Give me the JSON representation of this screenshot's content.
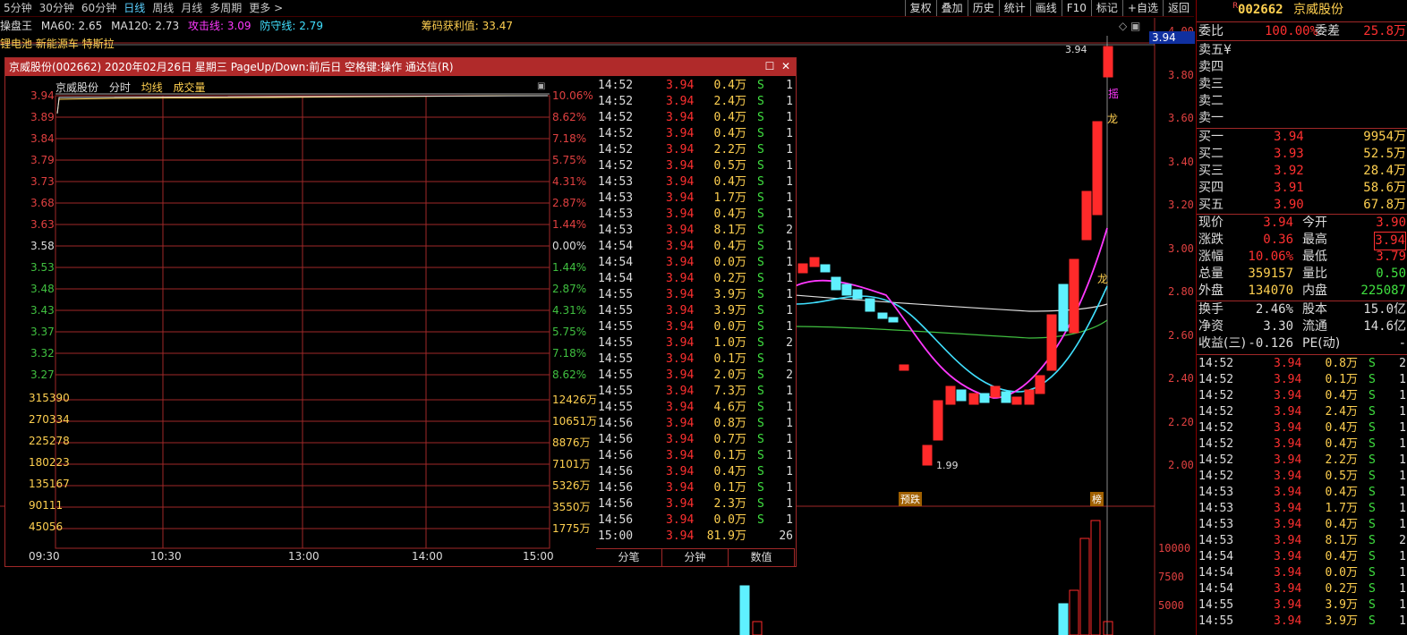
{
  "periods": [
    "5分钟",
    "30分钟",
    "60分钟",
    "日线",
    "周线",
    "月线",
    "多周期",
    "更多 >"
  ],
  "active_period": "日线",
  "top_buttons": [
    "复权",
    "叠加",
    "历史",
    "统计",
    "画线",
    "F10",
    "标记",
    "+自选",
    "返回"
  ],
  "indicators": {
    "name": "操盘王",
    "ma60": "MA60: 2.65",
    "ma120": "MA120: 2.73",
    "attack": "攻击线: 3.09",
    "defend": "防守线: 2.79",
    "chip": "筹码获利值: 33.47"
  },
  "concepts": "锂电池 新能源车 特斯拉",
  "price_axis": [
    "4.00",
    "3.80",
    "3.60",
    "3.40",
    "3.20",
    "3.00",
    "2.80",
    "2.60",
    "2.40",
    "2.20",
    "2.00"
  ],
  "price_marker": "3.94",
  "chart_labels": {
    "high": "3.94",
    "low": "1.99",
    "tag_warn": "预跌",
    "tag_rank": "榜",
    "mark_long": "龙",
    "mark_shake": "摇"
  },
  "volume_axis": [
    "10000",
    "7500",
    "5000"
  ],
  "colors": {
    "up": "#ff2a2a",
    "down": "#5ff0ff",
    "ma_white": "#e0e0e0",
    "ma_magenta": "#ff38ff",
    "ma_cyan": "#40e0ff",
    "ma_green": "#40c040",
    "accent": "#b02a2a"
  },
  "popup": {
    "title": "京威股份(002662) 2020年02月26日 星期三 PageUp/Down:前后日 空格键:操作 通达信(R)",
    "head": {
      "name": "京威股份",
      "tab1": "分时",
      "tab2": "均线",
      "tab3": "成交量"
    },
    "price_labels": [
      "3.94",
      "3.89",
      "3.84",
      "3.79",
      "3.73",
      "3.68",
      "3.63",
      "3.58",
      "3.53",
      "3.48",
      "3.43",
      "3.37",
      "3.32",
      "3.27"
    ],
    "pct_labels": [
      "10.06%",
      "8.62%",
      "7.18%",
      "5.75%",
      "4.31%",
      "2.87%",
      "1.44%",
      "0.00%",
      "1.44%",
      "2.87%",
      "4.31%",
      "5.75%",
      "7.18%",
      "8.62%"
    ],
    "vol_left": [
      "315390",
      "270334",
      "225278",
      "180223",
      "135167",
      "90111",
      "45056"
    ],
    "vol_right": [
      "12426万",
      "10651万",
      "8876万",
      "7101万",
      "5326万",
      "3550万",
      "1775万"
    ],
    "time_labels": [
      "09:30",
      "10:30",
      "13:00",
      "14:00",
      "15:00"
    ],
    "ticks": [
      [
        "14:52",
        "3.94",
        "0.4万",
        "S",
        "1"
      ],
      [
        "14:52",
        "3.94",
        "2.4万",
        "S",
        "1"
      ],
      [
        "14:52",
        "3.94",
        "0.4万",
        "S",
        "1"
      ],
      [
        "14:52",
        "3.94",
        "0.4万",
        "S",
        "1"
      ],
      [
        "14:52",
        "3.94",
        "2.2万",
        "S",
        "1"
      ],
      [
        "14:52",
        "3.94",
        "0.5万",
        "S",
        "1"
      ],
      [
        "14:53",
        "3.94",
        "0.4万",
        "S",
        "1"
      ],
      [
        "14:53",
        "3.94",
        "1.7万",
        "S",
        "1"
      ],
      [
        "14:53",
        "3.94",
        "0.4万",
        "S",
        "1"
      ],
      [
        "14:53",
        "3.94",
        "8.1万",
        "S",
        "2"
      ],
      [
        "14:54",
        "3.94",
        "0.4万",
        "S",
        "1"
      ],
      [
        "14:54",
        "3.94",
        "0.0万",
        "S",
        "1"
      ],
      [
        "14:54",
        "3.94",
        "0.2万",
        "S",
        "1"
      ],
      [
        "14:55",
        "3.94",
        "3.9万",
        "S",
        "1"
      ],
      [
        "14:55",
        "3.94",
        "3.9万",
        "S",
        "1"
      ],
      [
        "14:55",
        "3.94",
        "0.0万",
        "S",
        "1"
      ],
      [
        "14:55",
        "3.94",
        "1.0万",
        "S",
        "2"
      ],
      [
        "14:55",
        "3.94",
        "0.1万",
        "S",
        "1"
      ],
      [
        "14:55",
        "3.94",
        "2.0万",
        "S",
        "2"
      ],
      [
        "14:55",
        "3.94",
        "7.3万",
        "S",
        "1"
      ],
      [
        "14:55",
        "3.94",
        "4.6万",
        "S",
        "1"
      ],
      [
        "14:56",
        "3.94",
        "0.8万",
        "S",
        "1"
      ],
      [
        "14:56",
        "3.94",
        "0.7万",
        "S",
        "1"
      ],
      [
        "14:56",
        "3.94",
        "0.1万",
        "S",
        "1"
      ],
      [
        "14:56",
        "3.94",
        "0.4万",
        "S",
        "1"
      ],
      [
        "14:56",
        "3.94",
        "0.1万",
        "S",
        "1"
      ],
      [
        "14:56",
        "3.94",
        "2.3万",
        "S",
        "1"
      ],
      [
        "14:56",
        "3.94",
        "0.0万",
        "S",
        "1"
      ],
      [
        "15:00",
        "3.94",
        "81.9万",
        "",
        "26"
      ]
    ],
    "tabs": [
      "分笔",
      "分钟",
      "数值"
    ]
  },
  "quote": {
    "code": "002662",
    "name": "京威股份",
    "r_mark": "R",
    "weibi_label": "委比",
    "weibi": "100.00%",
    "weicha_label": "委差",
    "weicha": "25.8万",
    "sells": [
      [
        "卖五",
        "¥"
      ],
      [
        "卖四",
        ""
      ],
      [
        "卖三",
        ""
      ],
      [
        "卖二",
        ""
      ],
      [
        "卖一",
        ""
      ]
    ],
    "buys": [
      [
        "买一",
        "3.94",
        "9954万"
      ],
      [
        "买二",
        "3.93",
        "52.5万"
      ],
      [
        "买三",
        "3.92",
        "28.4万"
      ],
      [
        "买四",
        "3.91",
        "58.6万"
      ],
      [
        "买五",
        "3.90",
        "67.8万"
      ]
    ],
    "stats": [
      [
        "现价",
        "3.94",
        "今开",
        "3.90"
      ],
      [
        "涨跌",
        "0.36",
        "最高",
        "3.94"
      ],
      [
        "涨幅",
        "10.06%",
        "最低",
        "3.79"
      ],
      [
        "总量",
        "359157",
        "量比",
        "0.50"
      ],
      [
        "外盘",
        "134070",
        "内盘",
        "225087"
      ]
    ],
    "stats2": [
      [
        "换手",
        "2.46%",
        "股本",
        "15.0亿"
      ],
      [
        "净资",
        "3.30",
        "流通",
        "14.6亿"
      ],
      [
        "收益(三)",
        "-0.126",
        "PE(动)",
        "-"
      ]
    ],
    "ticks": [
      [
        "14:52",
        "3.94",
        "0.8万",
        "S",
        "2"
      ],
      [
        "14:52",
        "3.94",
        "0.1万",
        "S",
        "1"
      ],
      [
        "14:52",
        "3.94",
        "0.4万",
        "S",
        "1"
      ],
      [
        "14:52",
        "3.94",
        "2.4万",
        "S",
        "1"
      ],
      [
        "14:52",
        "3.94",
        "0.4万",
        "S",
        "1"
      ],
      [
        "14:52",
        "3.94",
        "0.4万",
        "S",
        "1"
      ],
      [
        "14:52",
        "3.94",
        "2.2万",
        "S",
        "1"
      ],
      [
        "14:52",
        "3.94",
        "0.5万",
        "S",
        "1"
      ],
      [
        "14:53",
        "3.94",
        "0.4万",
        "S",
        "1"
      ],
      [
        "14:53",
        "3.94",
        "1.7万",
        "S",
        "1"
      ],
      [
        "14:53",
        "3.94",
        "0.4万",
        "S",
        "1"
      ],
      [
        "14:53",
        "3.94",
        "8.1万",
        "S",
        "2"
      ],
      [
        "14:54",
        "3.94",
        "0.4万",
        "S",
        "1"
      ],
      [
        "14:54",
        "3.94",
        "0.0万",
        "S",
        "1"
      ],
      [
        "14:54",
        "3.94",
        "0.2万",
        "S",
        "1"
      ],
      [
        "14:55",
        "3.94",
        "3.9万",
        "S",
        "1"
      ],
      [
        "14:55",
        "3.94",
        "3.9万",
        "S",
        "1"
      ]
    ]
  }
}
